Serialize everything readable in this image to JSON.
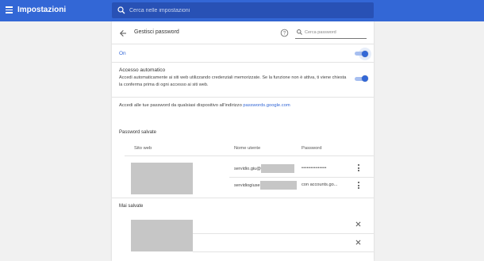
{
  "header": {
    "title": "Impostazioni",
    "search_placeholder": "Cerca nelle impostazioni"
  },
  "page": {
    "title": "Gestisci password",
    "filter_placeholder": "Cerca password"
  },
  "offer_save": {
    "label": "On",
    "enabled": true
  },
  "auto_signin": {
    "title": "Accesso automatico",
    "description": "Accedi automaticamente ai siti web utilizzando credenziali memorizzate. Se la funzione non è attiva, ti viene chiesta la conferma prima di ogni accesso ai siti web.",
    "enabled": true
  },
  "account_link": {
    "text": "Accedi alle tue password da qualsiasi dispositivo all'indirizzo ",
    "link": "passwords.google.com"
  },
  "saved": {
    "title": "Password salvate",
    "columns": [
      "Sito web",
      "Nome utente",
      "Password"
    ],
    "rows": [
      {
        "username": "servidio.giu@",
        "password": "••••••••••••••"
      },
      {
        "username": "servidiogiuse",
        "password": "con accounts.go..."
      }
    ]
  },
  "never_saved": {
    "title": "Mai salvate"
  },
  "colors": {
    "accent": "#3367d6",
    "redacted": "#c6c6c6"
  }
}
